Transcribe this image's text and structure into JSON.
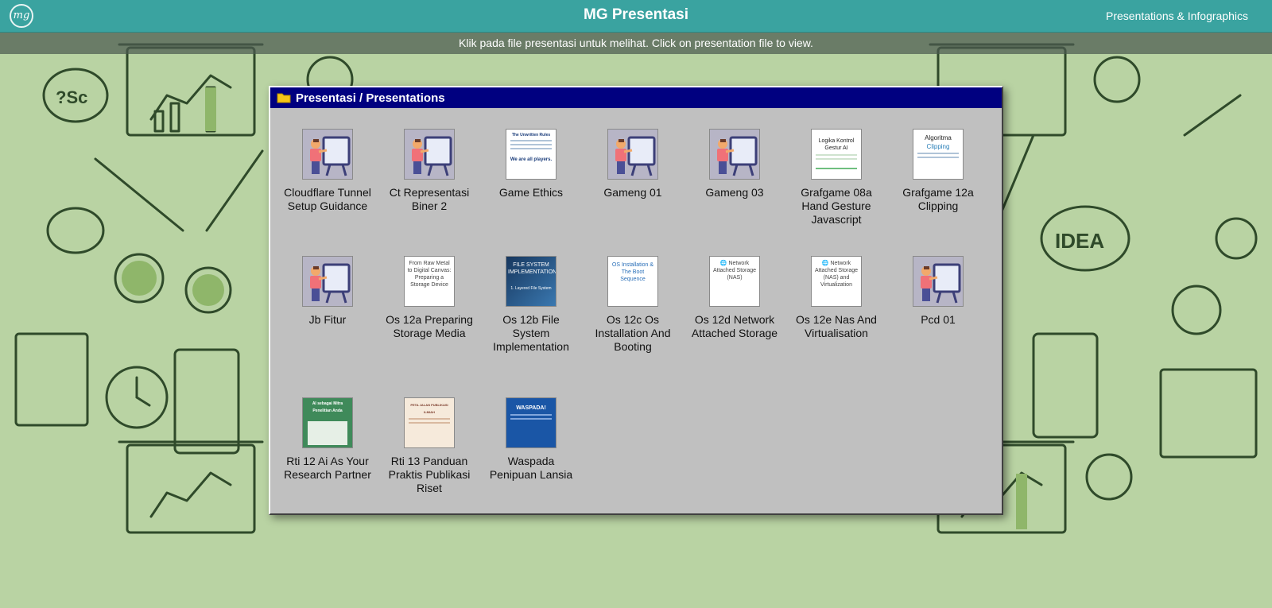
{
  "header": {
    "logo_text": "mg",
    "title": "MG Presentasi",
    "nav_link": "Presentations & Infographics"
  },
  "subheader": {
    "text": "Klik pada file presentasi untuk melihat. Click on presentation file to view."
  },
  "window": {
    "title": "Presentasi / Presentations",
    "files": [
      {
        "label": "Cloudflare Tunnel Setup Guidance",
        "thumb": "presenter"
      },
      {
        "label": "Ct Representasi Biner 2",
        "thumb": "presenter"
      },
      {
        "label": "Game Ethics",
        "thumb": "doc-blue",
        "thumb_title": "The Unwritten Rules",
        "thumb_footer": "We are all players."
      },
      {
        "label": "Gameng 01",
        "thumb": "presenter"
      },
      {
        "label": "Gameng 03",
        "thumb": "presenter"
      },
      {
        "label": "Grafgame 08a Hand Gesture Javascript",
        "thumb": "doc-green",
        "thumb_title": "Logika Kontrol Gestur AI"
      },
      {
        "label": "Grafgame 12a Clipping",
        "thumb": "doc-plain",
        "thumb_title": "Algoritma",
        "thumb_sub": "Clipping"
      },
      {
        "label": "Jb Fitur",
        "thumb": "presenter"
      },
      {
        "label": "Os 12a Preparing Storage Media",
        "thumb": "doc-text",
        "thumb_title": "From Raw Metal to Digital Canvas: Preparing a Storage Device"
      },
      {
        "label": "Os 12b File System Implementation",
        "thumb": "doc-dark",
        "thumb_title": "FILE SYSTEM IMPLEMENTATION",
        "thumb_footer": "1. Layered File System"
      },
      {
        "label": "Os 12c Os Installation And Booting",
        "thumb": "doc-blue-text",
        "thumb_title": "OS Installation & The Boot Sequence"
      },
      {
        "label": "Os 12d Network Attached Storage",
        "thumb": "doc-text",
        "thumb_title": "🌐 Network Attached Storage (NAS)"
      },
      {
        "label": "Os 12e Nas And Virtualisation",
        "thumb": "doc-text",
        "thumb_title": "🌐 Network Attached Storage (NAS) and Virtualization"
      },
      {
        "label": "Pcd 01",
        "thumb": "presenter"
      },
      {
        "label": "Rti 12 Ai As Your Research Partner",
        "thumb": "doc-greenbg",
        "thumb_title": "AI sebagai Mitra Penelitian Anda"
      },
      {
        "label": "Rti 13 Panduan Praktis Publikasi Riset",
        "thumb": "doc-cream",
        "thumb_title": "PETA JALAN PUBLIKASI ILMIAH"
      },
      {
        "label": "Waspada Penipuan Lansia",
        "thumb": "doc-navy",
        "thumb_title": "WASPADA!"
      }
    ]
  },
  "colors": {
    "topbar": "#3aa3a0",
    "window_title": "#000080",
    "window_bg": "#c0c0c0",
    "background": "#b9d3a3"
  }
}
